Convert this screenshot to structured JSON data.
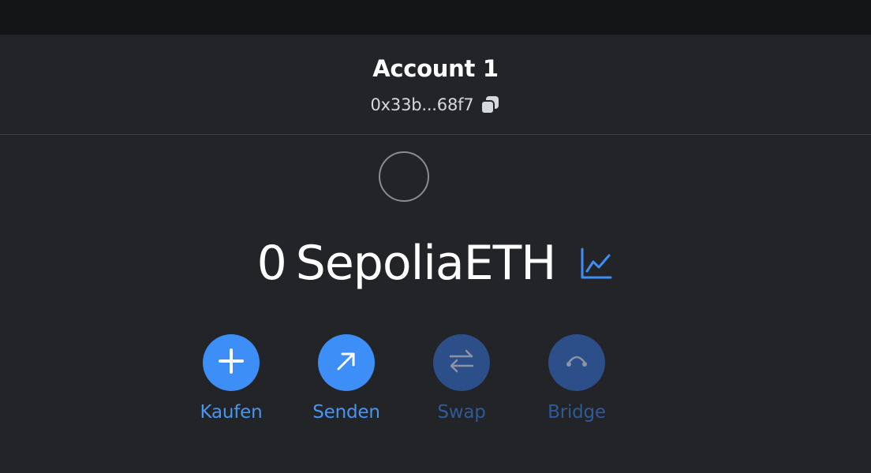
{
  "account": {
    "name": "Account 1",
    "address": "0x33b...68f7"
  },
  "balance": {
    "value": "0",
    "unit": "SepoliaETH"
  },
  "actions": [
    {
      "label": "Kaufen",
      "icon": "plus-icon",
      "enabled": true
    },
    {
      "label": "Senden",
      "icon": "arrow-up-right-icon",
      "enabled": true
    },
    {
      "label": "Swap",
      "icon": "swap-arrows-icon",
      "enabled": false
    },
    {
      "label": "Bridge",
      "icon": "bridge-icon",
      "enabled": false
    }
  ],
  "colors": {
    "background": "#232427",
    "top_bar": "#141517",
    "accent": "#3d8ef6",
    "accent_disabled": "#2c4f89",
    "divider": "#3b3c40"
  }
}
